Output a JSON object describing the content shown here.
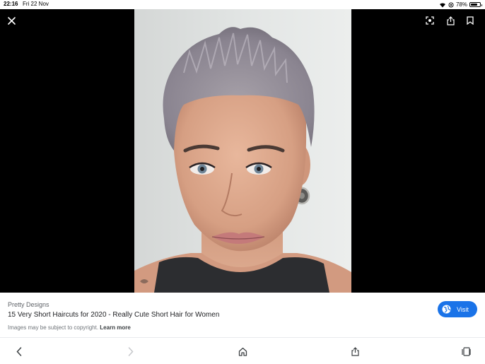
{
  "status_bar": {
    "time": "22:16",
    "date": "Fri 22 Nov",
    "battery": "78%",
    "battery_level": 0.78
  },
  "viewer": {
    "icons": [
      "close-icon",
      "lens-icon",
      "share-icon",
      "bookmark-icon"
    ]
  },
  "info": {
    "source": "Pretty Designs",
    "title": "15 Very Short Haircuts for 2020 - Really Cute Short Hair for Women",
    "copyright_text": "Images may be subject to copyright.",
    "learn_more": "Learn more",
    "visit_label": "Visit"
  },
  "toolbar": {
    "icons": [
      "back-icon",
      "forward-icon",
      "home-icon",
      "share-icon",
      "tabs-icon"
    ]
  },
  "colors": {
    "accent": "#1a73e8",
    "viewer_bg": "#000000"
  }
}
